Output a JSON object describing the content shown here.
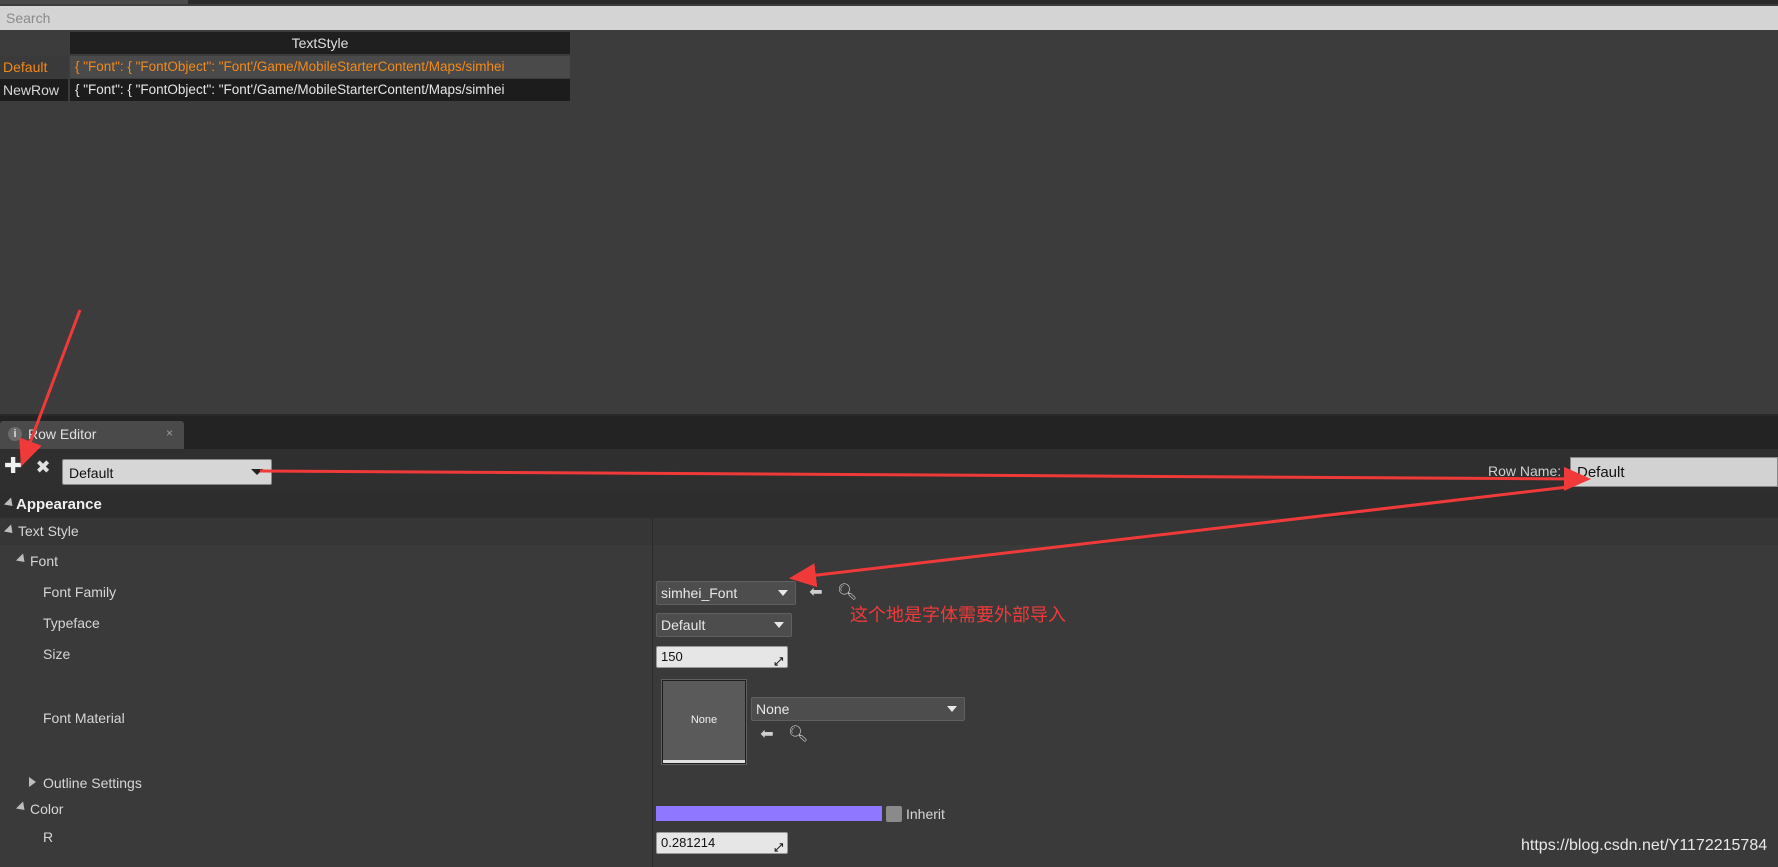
{
  "search": {
    "placeholder": "Search"
  },
  "table": {
    "header": "TextStyle",
    "rows": [
      {
        "name": "Default",
        "value": "{ \"Font\": { \"FontObject\": \"Font'/Game/MobileStarterContent/Maps/simhei",
        "selected": true
      },
      {
        "name": "NewRow",
        "value": "{ \"Font\": { \"FontObject\": \"Font'/Game/MobileStarterContent/Maps/simhei",
        "selected": false
      }
    ]
  },
  "tab": {
    "title": "Row Editor",
    "info_icon": "i",
    "close": "×"
  },
  "toolbar": {
    "add_icon": "✚",
    "remove_icon": "✖",
    "row_select_value": "Default",
    "row_name_label": "Row Name:",
    "row_name_value": "Default"
  },
  "properties": {
    "appearance_label": "Appearance",
    "text_style_label": "Text Style",
    "font_label": "Font",
    "font_family_label": "Font Family",
    "font_family_value": "simhei_Font",
    "typeface_label": "Typeface",
    "typeface_value": "Default",
    "size_label": "Size",
    "size_value": "150",
    "font_material_label": "Font Material",
    "font_material_thumb": "None",
    "font_material_value": "None",
    "outline_label": "Outline Settings",
    "color_label": "Color",
    "color_swatch": "#8f78ff",
    "inherit_label": "Inherit",
    "r_label": "R",
    "r_value": "0.281214"
  },
  "annotations": {
    "note": "这个地是字体需要外部导入",
    "arrow_color": "#f03a3a"
  },
  "watermark": "https://blog.csdn.net/Y1172215784"
}
